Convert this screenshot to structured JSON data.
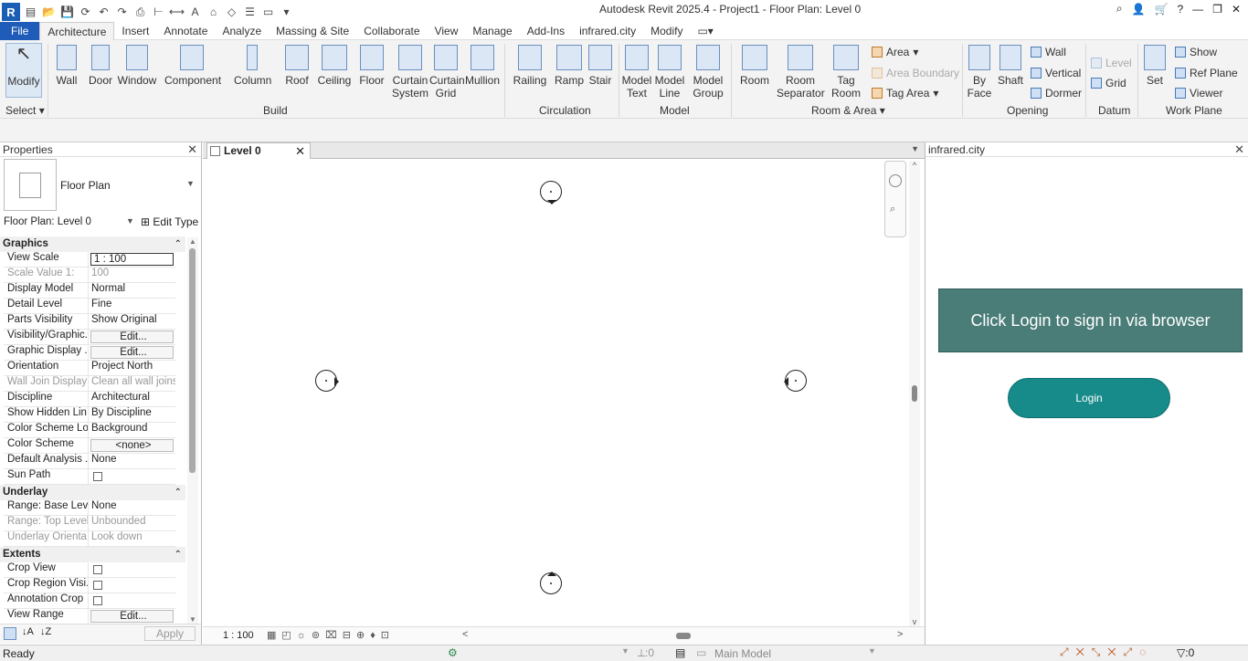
{
  "title": "Autodesk Revit 2025.4 - Project1 - Floor Plan: Level 0",
  "menu": [
    "File",
    "Architecture",
    "Insert",
    "Annotate",
    "Analyze",
    "Massing & Site",
    "Collaborate",
    "View",
    "Manage",
    "Add-Ins",
    "infrared.city",
    "Modify"
  ],
  "ribbon": {
    "select": {
      "modify": "Modify",
      "select": "Select"
    },
    "build": [
      "Wall",
      "Door",
      "Window",
      "Component",
      "Column",
      "Roof",
      "Ceiling",
      "Floor",
      "Curtain System",
      "Curtain Grid",
      "Mullion"
    ],
    "build_label": "Build",
    "circulation": [
      "Railing",
      "Ramp",
      "Stair"
    ],
    "circulation_label": "Circulation",
    "model": [
      "Model Text",
      "Model Line",
      "Model Group"
    ],
    "model_label": "Model",
    "room": [
      "Room",
      "Room Separator",
      "Tag Room"
    ],
    "room_small": [
      "Area",
      "Area Boundary",
      "Tag Area"
    ],
    "room_label": "Room & Area",
    "opening": [
      "By Face",
      "Shaft"
    ],
    "opening_small": [
      "Wall",
      "Vertical",
      "Dormer"
    ],
    "opening_label": "Opening",
    "datum_small": [
      "Level",
      "Grid"
    ],
    "datum_label": "Datum",
    "workplane": [
      "Set"
    ],
    "workplane_small": [
      "Show",
      "Ref Plane",
      "Viewer"
    ],
    "workplane_label": "Work Plane"
  },
  "properties": {
    "header": "Properties",
    "type": "Floor Plan",
    "instance": "Floor Plan: Level 0",
    "edit_type": "Edit Type",
    "apply": "Apply",
    "rows": [
      {
        "cat": "Graphics"
      },
      {
        "k": "View Scale",
        "v": "1 : 100",
        "box": true
      },
      {
        "k": "Scale Value    1:",
        "v": "100",
        "dis": true
      },
      {
        "k": "Display Model",
        "v": "Normal"
      },
      {
        "k": "Detail Level",
        "v": "Fine"
      },
      {
        "k": "Parts Visibility",
        "v": "Show Original"
      },
      {
        "k": "Visibility/Graphic...",
        "v": "Edit...",
        "btn": true
      },
      {
        "k": "Graphic Display ...",
        "v": "Edit...",
        "btn": true
      },
      {
        "k": "Orientation",
        "v": "Project North"
      },
      {
        "k": "Wall Join Display",
        "v": "Clean all wall joins",
        "dis": true
      },
      {
        "k": "Discipline",
        "v": "Architectural"
      },
      {
        "k": "Show Hidden Lin...",
        "v": "By Discipline"
      },
      {
        "k": "Color Scheme Lo...",
        "v": "Background"
      },
      {
        "k": "Color Scheme",
        "v": "<none>",
        "btn": true
      },
      {
        "k": "Default Analysis ...",
        "v": "None"
      },
      {
        "k": "Sun Path",
        "v": "",
        "chk": true
      },
      {
        "cat": "Underlay"
      },
      {
        "k": "Range: Base Level",
        "v": "None"
      },
      {
        "k": "Range: Top Level",
        "v": "Unbounded",
        "dis": true
      },
      {
        "k": "Underlay Orienta...",
        "v": "Look down",
        "dis": true
      },
      {
        "cat": "Extents"
      },
      {
        "k": "Crop View",
        "v": "",
        "chk": true
      },
      {
        "k": "Crop Region Visi...",
        "v": "",
        "chk": true
      },
      {
        "k": "Annotation Crop",
        "v": "",
        "chk": true
      },
      {
        "k": "View Range",
        "v": "Edit...",
        "btn": true
      }
    ]
  },
  "view": {
    "tab": "Level 0",
    "scale": "1 : 100"
  },
  "plugin": {
    "title": "infrared.city",
    "banner": "Click Login to sign in via browser",
    "login": "Login"
  },
  "status": {
    "text": "Ready",
    "count": ":0",
    "model": "Main Model",
    "filter": ":0"
  }
}
